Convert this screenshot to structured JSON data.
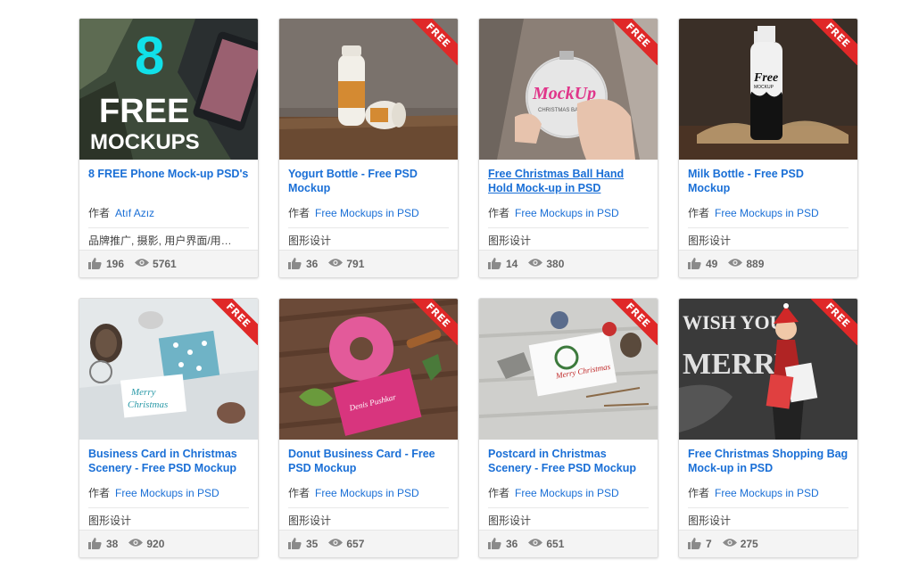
{
  "author_label": "作者",
  "ribbon_label": "FREE",
  "cards": [
    {
      "title": "8 FREE Phone Mock-up PSD's",
      "author": "Atıf Azız",
      "tags": "品牌推广, 摄影, 用户界面/用…",
      "likes": "196",
      "views": "5761",
      "thumb_text_big": "8",
      "thumb_text_line1": "FREE",
      "thumb_text_line2": "MOCKUPS"
    },
    {
      "title": "Yogurt Bottle - Free PSD Mockup",
      "author": "Free Mockups in PSD",
      "tags": "图形设计",
      "likes": "36",
      "views": "791"
    },
    {
      "title": "Free Christmas Ball Hand Hold Mock-up in PSD",
      "author": "Free Mockups in PSD",
      "tags": "图形设计",
      "likes": "14",
      "views": "380",
      "thumb_text_big": "MockUp",
      "thumb_text_line1": "CHRISTMAS BALL"
    },
    {
      "title": "Milk Bottle - Free PSD Mockup",
      "author": "Free Mockups in PSD",
      "tags": "图形设计",
      "likes": "49",
      "views": "889",
      "thumb_text_big": "Free",
      "thumb_text_line1": "MOCKUP"
    },
    {
      "title": "Business Card in Christmas Scenery - Free PSD Mockup",
      "author": "Free Mockups in PSD",
      "tags": "图形设计",
      "likes": "38",
      "views": "920",
      "thumb_text_big": "Merry",
      "thumb_text_line1": "Christmas"
    },
    {
      "title": "Donut Business Card - Free PSD Mockup",
      "author": "Free Mockups in PSD",
      "tags": "图形设计",
      "likes": "35",
      "views": "657",
      "thumb_text_big": "Denis Pushkar"
    },
    {
      "title": "Postcard in Christmas Scenery - Free PSD Mockup",
      "author": "Free Mockups in PSD",
      "tags": "图形设计",
      "likes": "36",
      "views": "651",
      "thumb_text_big": "Merry Christmas"
    },
    {
      "title": "Free Christmas Shopping Bag Mock-up in PSD",
      "author": "Free Mockups in PSD",
      "tags": "图形设计",
      "likes": "7",
      "views": "275",
      "thumb_text_big": "WISH YOU",
      "thumb_text_line1": "MERRY"
    }
  ],
  "colors": {
    "link": "#1a6fd6",
    "ribbon": "#e02828",
    "stats_bg": "#f4f4f4"
  },
  "icons": {
    "like": "thumbs-up-icon",
    "views": "eye-icon"
  }
}
